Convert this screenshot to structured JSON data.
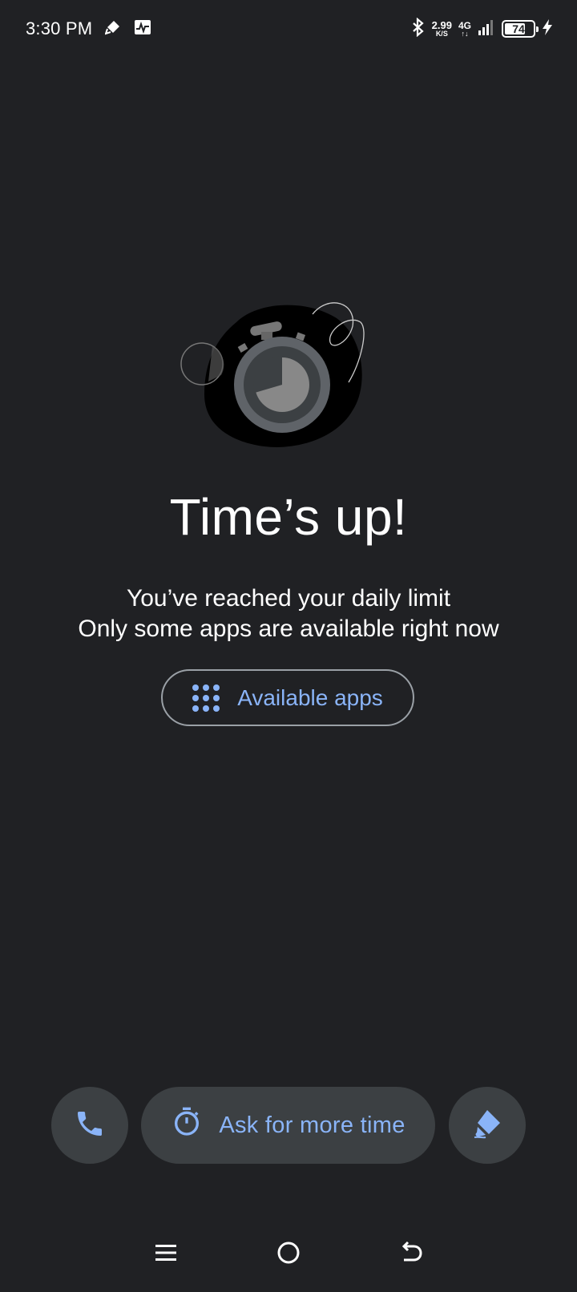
{
  "status_bar": {
    "time": "3:30 PM",
    "net_speed_value": "2.99",
    "net_speed_unit": "K/S",
    "network_type": "4G",
    "network_arrows": "↑↓",
    "battery_level": "74",
    "battery_fraction": 0.74,
    "icons": [
      "edit-pen-icon",
      "activity-image-icon",
      "bluetooth-icon",
      "signal-icon",
      "battery-icon",
      "charging-bolt-icon"
    ]
  },
  "main": {
    "title": "Time’s up!",
    "subtitle_line1": "You’ve reached your daily limit",
    "subtitle_line2": "Only some apps are available right now",
    "available_apps_label": "Available apps"
  },
  "actions": {
    "call_icon": "phone-icon",
    "more_time_label": "Ask for more time",
    "more_time_icon": "timer-icon",
    "settings_icon": "family-link-icon"
  },
  "colors": {
    "background": "#202124",
    "accent": "#8ab4f8",
    "button_bg": "#3c4043"
  },
  "nav": {
    "icons": [
      "menu-icon",
      "home-icon",
      "back-icon"
    ]
  }
}
